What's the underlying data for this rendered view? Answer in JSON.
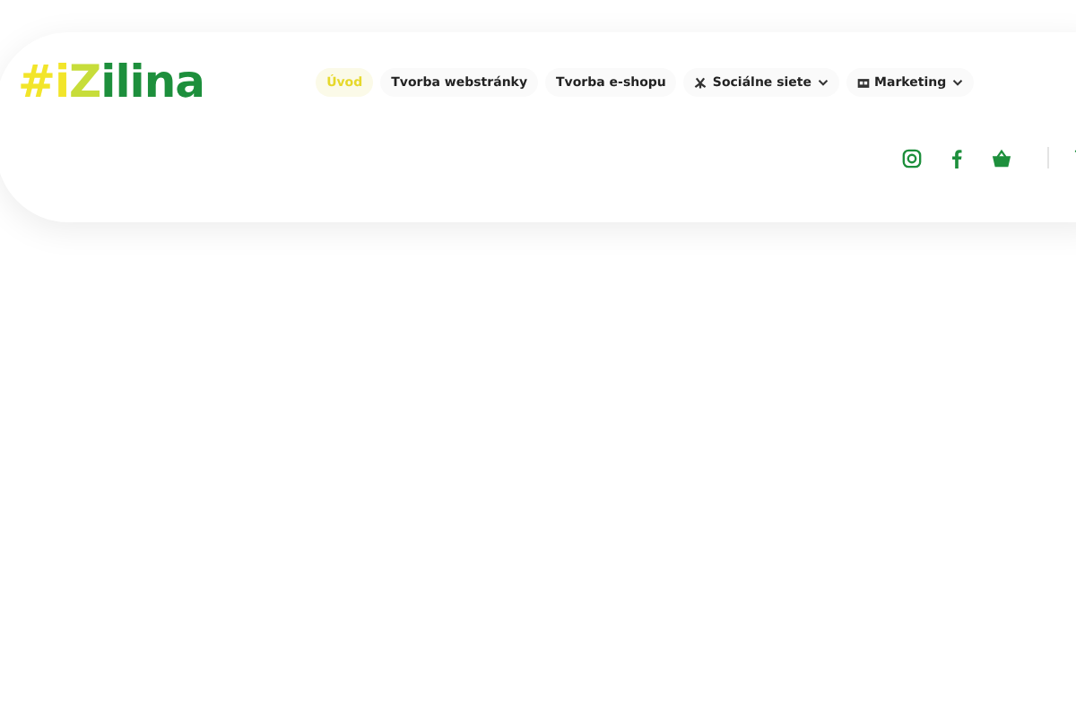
{
  "logo": {
    "prefix": "#i",
    "mark": "Z",
    "rest": "ilina"
  },
  "nav": [
    {
      "label": "Úvod",
      "selected": true,
      "kind": "plain"
    },
    {
      "label": "Tvorba webstránky",
      "selected": false,
      "kind": "plain"
    },
    {
      "label": "Tvorba e-shopu",
      "selected": false,
      "kind": "plain"
    },
    {
      "label": "Sociálne siete",
      "selected": false,
      "kind": "social"
    },
    {
      "label": "Marketing",
      "selected": false,
      "kind": "marketing"
    }
  ]
}
